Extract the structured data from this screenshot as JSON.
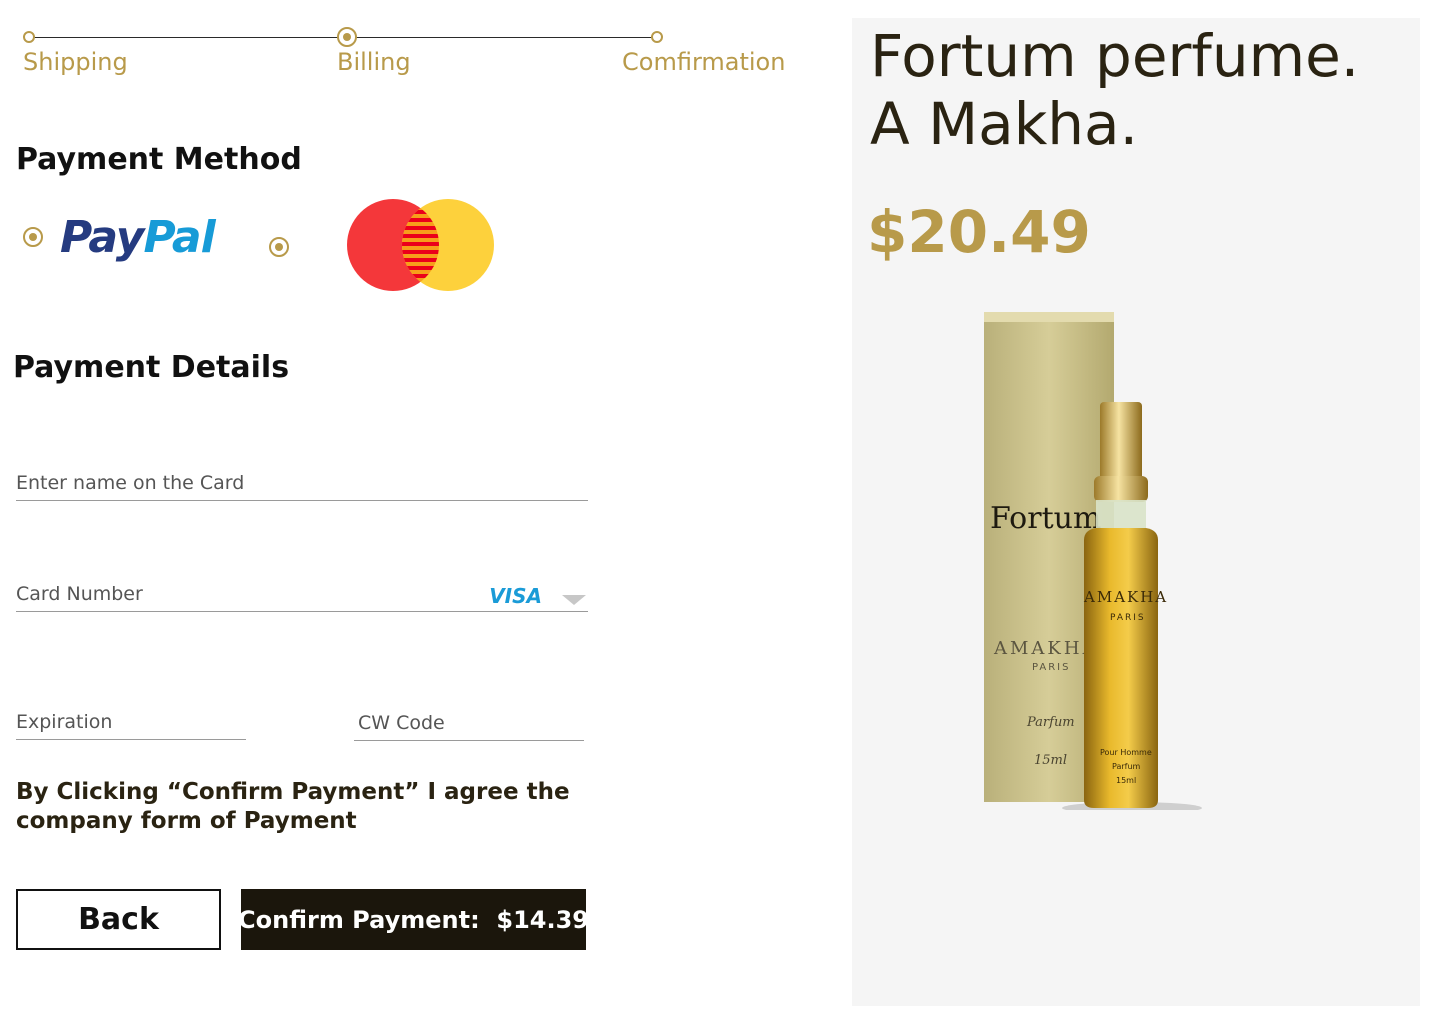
{
  "stepper": {
    "steps": [
      {
        "label": "Shipping"
      },
      {
        "label": "Billing"
      },
      {
        "label": "Comfirmation"
      }
    ]
  },
  "payment_method": {
    "heading": "Payment Method",
    "paypal_logo": "PayPal",
    "options": [
      "paypal",
      "mastercard"
    ]
  },
  "payment_details": {
    "heading": "Payment Details",
    "name_label": "Enter name on the Card",
    "card_number_label": "Card Number",
    "card_brand": "VISA",
    "expiration_label": "Expiration",
    "cvv_label": "CW Code"
  },
  "agreement_text": "By Clicking “Confirm Payment” I agree the company form of Payment",
  "buttons": {
    "back_label": "Back",
    "confirm_label": "Confirm Payment:  $14.39"
  },
  "product": {
    "title": "Fortum perfume. A Makha.",
    "price": "$20.49",
    "image_text": {
      "box_brand": "Fortum",
      "maker": "AMAKHA",
      "city": "PARIS",
      "kind": "Parfum",
      "volume": "15ml",
      "line": "Pour Homme"
    }
  },
  "colors": {
    "accent": "#b89a4a",
    "dark": "#1b160c",
    "panel": "#f5f5f5"
  }
}
